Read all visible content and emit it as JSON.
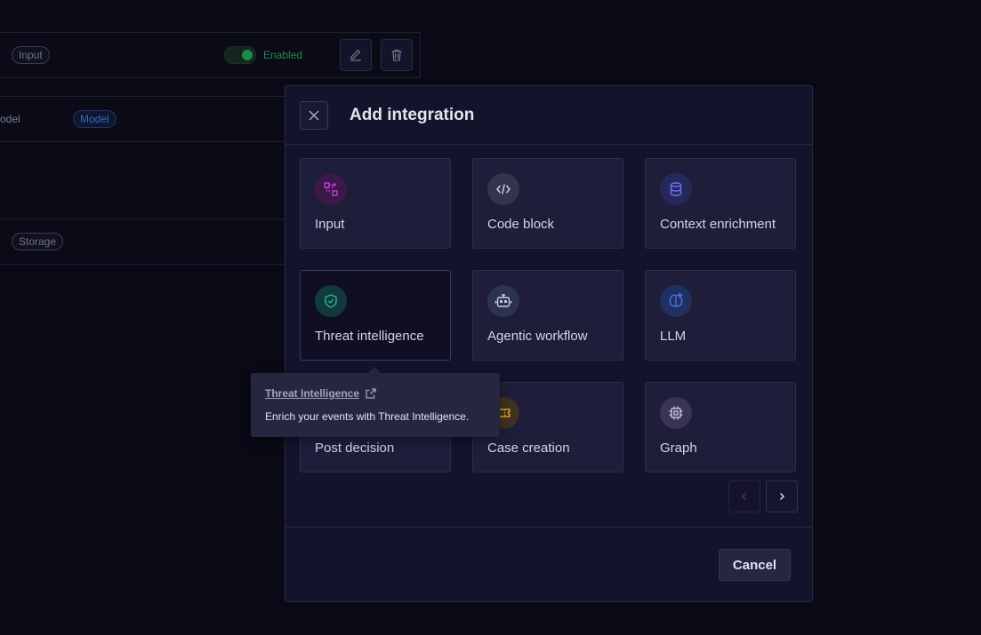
{
  "background": {
    "row1": {
      "pill": "Input",
      "status": "Enabled"
    },
    "row2": {
      "label": "odel",
      "pill": "Model"
    },
    "row3": {
      "pill": "Storage"
    }
  },
  "modal": {
    "title": "Add integration",
    "cards": [
      {
        "label": "Input",
        "icon": "input-icon"
      },
      {
        "label": "Code block",
        "icon": "code-icon"
      },
      {
        "label": "Context enrichment",
        "icon": "database-icon"
      },
      {
        "label": "Threat intelligence",
        "icon": "shield-check-icon"
      },
      {
        "label": "Agentic workflow",
        "icon": "robot-icon"
      },
      {
        "label": "LLM",
        "icon": "brain-icon"
      },
      {
        "label": "Post decision",
        "icon": "decision-icon"
      },
      {
        "label": "Case creation",
        "icon": "ticket-icon"
      },
      {
        "label": "Graph",
        "icon": "chip-icon"
      }
    ],
    "cancel_label": "Cancel"
  },
  "tooltip": {
    "title": "Threat Intelligence",
    "description": "Enrich your events with Threat Intelligence."
  },
  "colors": {
    "accent_magenta": "#c13bd6",
    "accent_teal": "#2bb39a",
    "accent_blue": "#4a73e8",
    "accent_amber": "#e0a12a",
    "enabled_green": "#1d8a4e"
  }
}
